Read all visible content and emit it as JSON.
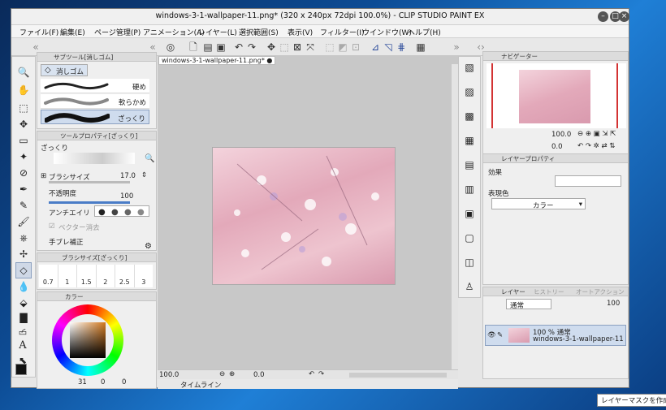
{
  "window": {
    "title": "windows-3-1-wallpaper-11.png* (320 x 240px 72dpi 100.0%) - CLIP STUDIO PAINT EX"
  },
  "menu": [
    "ファイル(F)",
    "編集(E)",
    "ページ管理(P)",
    "アニメーション(A)",
    "レイヤー(L)",
    "選択範囲(S)",
    "表示(V)",
    "フィルター(I)",
    "ウインドウ(W)",
    "ヘルプ(H)"
  ],
  "subtool": {
    "tab_label": "サブツール[消しゴム]",
    "group_label": "消しゴム",
    "items": [
      "硬め",
      "軟らかめ",
      "ざっくり"
    ]
  },
  "tool_property": {
    "tab_label": "ツールプロパティ[ざっくり]",
    "preset_name": "ざっくり",
    "brush_size_label": "ブラシサイズ",
    "brush_size_value": "17.0",
    "opacity_label": "不透明度",
    "opacity_value": "100",
    "antialias_label": "アンチエイリ",
    "vector_label": "ベクター消去",
    "correction_label": "手ブレ補正"
  },
  "brush_size_panel": {
    "tab_label": "ブラシサイズ[ざっくり]",
    "sizes": [
      "0.7",
      "1",
      "1.5",
      "2",
      "2.5",
      "3"
    ]
  },
  "color_panel": {
    "tab_label": "カラー",
    "hsv": {
      "h": "31",
      "s": "0",
      "v": "0"
    }
  },
  "document": {
    "tab": "windows-3-1-wallpaper-11.png*",
    "zoom": "100.0",
    "angle": "0.0",
    "timeline_label": "タイムライン"
  },
  "navigator": {
    "tab_label": "ナビゲーター",
    "zoom": "100.0",
    "angle": "0.0"
  },
  "layer_property": {
    "tab_label": "レイヤープロパティ",
    "effect_label": "効果",
    "color_label": "表現色",
    "color_value": "カラー"
  },
  "layer_panel": {
    "tab_label": "レイヤー",
    "history_label": "ヒストリー",
    "auto_action_label": "オートアクション",
    "blend_mode": "通常",
    "opacity": "100",
    "layers": [
      {
        "opacity_mode": "100 % 通常",
        "name": "windows-3-1-wallpaper-11"
      }
    ]
  },
  "tooltip": "レイヤーマスクを作成",
  "colors": {
    "canvas_pink": "#e8b9c6",
    "desktop_blue": "#1f7fd6",
    "accent": "#d33333"
  }
}
